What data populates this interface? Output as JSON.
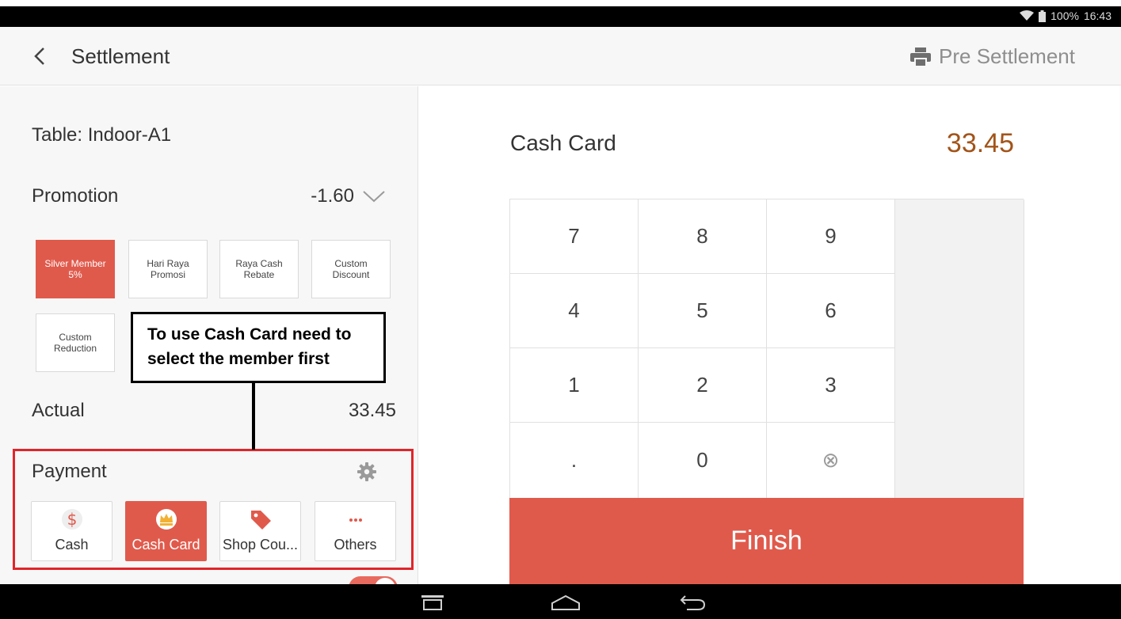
{
  "status_bar": {
    "battery": "100%",
    "time": "16:43"
  },
  "header": {
    "title": "Settlement",
    "pre_settlement": "Pre Settlement"
  },
  "left": {
    "table_label": "Table:",
    "table_value": "Indoor-A1",
    "promotion_label": "Promotion",
    "promotion_value": "-1.60",
    "promotions": [
      {
        "line1": "Silver Member",
        "line2": "5%",
        "active": true
      },
      {
        "line1": "Hari Raya",
        "line2": "Promosi",
        "active": false
      },
      {
        "line1": "Raya Cash",
        "line2": "Rebate",
        "active": false
      },
      {
        "line1": "Custom",
        "line2": "Discount",
        "active": false
      },
      {
        "line1": "Custom",
        "line2": "Reduction",
        "active": false
      }
    ],
    "actual_label": "Actual",
    "actual_value": "33.45",
    "payment_label": "Payment",
    "payments": [
      {
        "label": "Cash",
        "icon": "dollar-icon",
        "active": false
      },
      {
        "label": "Cash Card",
        "icon": "crown-icon",
        "active": true
      },
      {
        "label": "Shop Cou...",
        "icon": "tag-icon",
        "active": false
      },
      {
        "label": "Others",
        "icon": "more-dots-icon",
        "active": false
      }
    ],
    "callout": {
      "line1": "To use Cash Card need to",
      "line2": "select the member first"
    }
  },
  "right": {
    "method": "Cash Card",
    "amount": "33.45",
    "keys": [
      [
        "7",
        "8",
        "9"
      ],
      [
        "4",
        "5",
        "6"
      ],
      [
        "1",
        "2",
        "3"
      ],
      [
        ".",
        "0",
        "⊗"
      ]
    ],
    "finish": "Finish"
  },
  "colors": {
    "accent": "#e05a4c",
    "amount": "#a25419",
    "highlight_frame": "#e0252b"
  }
}
